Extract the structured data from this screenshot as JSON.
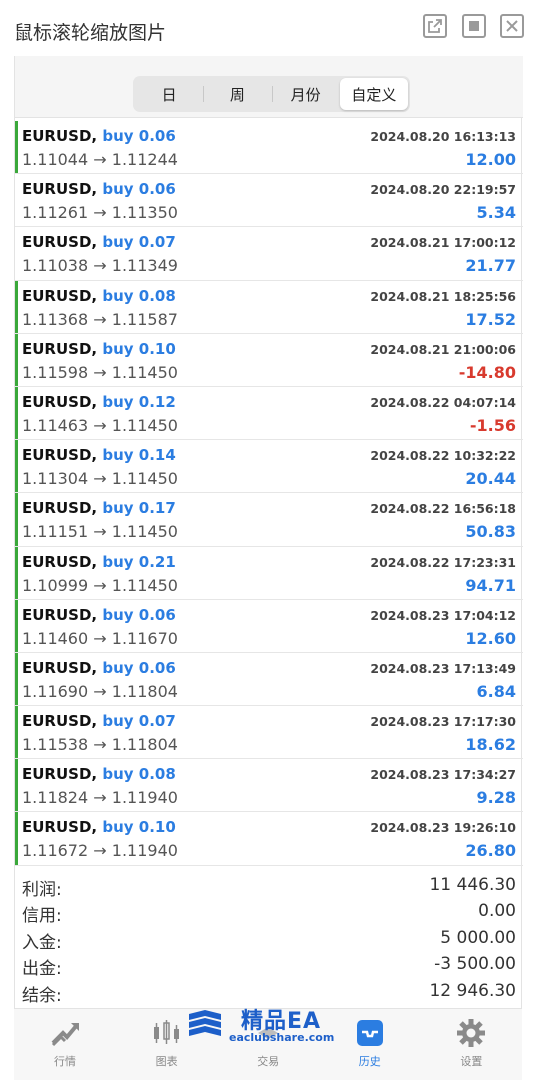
{
  "window": {
    "title": "鼠标滚轮缩放图片"
  },
  "period_tabs": [
    {
      "label": "日",
      "active": false
    },
    {
      "label": "周",
      "active": false
    },
    {
      "label": "月份",
      "active": false
    },
    {
      "label": "自定义",
      "active": true
    }
  ],
  "trades": [
    {
      "symbol": "EURUSD,",
      "side": "buy 0.06",
      "time": "2024.08.20 16:13:13",
      "open": "1.11044",
      "arrow": "→",
      "close": "1.11244",
      "profit": "12.00",
      "bar": true
    },
    {
      "symbol": "EURUSD,",
      "side": "buy 0.06",
      "time": "2024.08.20 22:19:57",
      "open": "1.11261",
      "arrow": "→",
      "close": "1.11350",
      "profit": "5.34",
      "bar": false
    },
    {
      "symbol": "EURUSD,",
      "side": "buy 0.07",
      "time": "2024.08.21 17:00:12",
      "open": "1.11038",
      "arrow": "→",
      "close": "1.11349",
      "profit": "21.77",
      "bar": false
    },
    {
      "symbol": "EURUSD,",
      "side": "buy 0.08",
      "time": "2024.08.21 18:25:56",
      "open": "1.11368",
      "arrow": "→",
      "close": "1.11587",
      "profit": "17.52",
      "bar": true
    },
    {
      "symbol": "EURUSD,",
      "side": "buy 0.10",
      "time": "2024.08.21 21:00:06",
      "open": "1.11598",
      "arrow": "→",
      "close": "1.11450",
      "profit": "-14.80",
      "bar": true
    },
    {
      "symbol": "EURUSD,",
      "side": "buy 0.12",
      "time": "2024.08.22 04:07:14",
      "open": "1.11463",
      "arrow": "→",
      "close": "1.11450",
      "profit": "-1.56",
      "bar": true
    },
    {
      "symbol": "EURUSD,",
      "side": "buy 0.14",
      "time": "2024.08.22 10:32:22",
      "open": "1.11304",
      "arrow": "→",
      "close": "1.11450",
      "profit": "20.44",
      "bar": true
    },
    {
      "symbol": "EURUSD,",
      "side": "buy 0.17",
      "time": "2024.08.22 16:56:18",
      "open": "1.11151",
      "arrow": "→",
      "close": "1.11450",
      "profit": "50.83",
      "bar": true
    },
    {
      "symbol": "EURUSD,",
      "side": "buy 0.21",
      "time": "2024.08.22 17:23:31",
      "open": "1.10999",
      "arrow": "→",
      "close": "1.11450",
      "profit": "94.71",
      "bar": true
    },
    {
      "symbol": "EURUSD,",
      "side": "buy 0.06",
      "time": "2024.08.23 17:04:12",
      "open": "1.11460",
      "arrow": "→",
      "close": "1.11670",
      "profit": "12.60",
      "bar": true
    },
    {
      "symbol": "EURUSD,",
      "side": "buy 0.06",
      "time": "2024.08.23 17:13:49",
      "open": "1.11690",
      "arrow": "→",
      "close": "1.11804",
      "profit": "6.84",
      "bar": true
    },
    {
      "symbol": "EURUSD,",
      "side": "buy 0.07",
      "time": "2024.08.23 17:17:30",
      "open": "1.11538",
      "arrow": "→",
      "close": "1.11804",
      "profit": "18.62",
      "bar": true
    },
    {
      "symbol": "EURUSD,",
      "side": "buy 0.08",
      "time": "2024.08.23 17:34:27",
      "open": "1.11824",
      "arrow": "→",
      "close": "1.11940",
      "profit": "9.28",
      "bar": true
    },
    {
      "symbol": "EURUSD,",
      "side": "buy 0.10",
      "time": "2024.08.23 19:26:10",
      "open": "1.11672",
      "arrow": "→",
      "close": "1.11940",
      "profit": "26.80",
      "bar": true
    }
  ],
  "summary": [
    {
      "label": "利润:",
      "value": "11 446.30"
    },
    {
      "label": "信用:",
      "value": "0.00"
    },
    {
      "label": "入金:",
      "value": "5 000.00"
    },
    {
      "label": "出金:",
      "value": "-3 500.00"
    },
    {
      "label": "结余:",
      "value": "12 946.30"
    }
  ],
  "tabbar": [
    {
      "label": "行情",
      "icon": "quotes-icon",
      "active": false
    },
    {
      "label": "图表",
      "icon": "chart-icon",
      "active": false
    },
    {
      "label": "交易",
      "icon": "trade-icon",
      "active": false
    },
    {
      "label": "历史",
      "icon": "history-icon",
      "active": true
    },
    {
      "label": "设置",
      "icon": "settings-icon",
      "active": false
    }
  ],
  "watermark": {
    "title": "精品EA",
    "url": "eaclubshare.com"
  },
  "colors": {
    "accent": "#2b7de1",
    "loss": "#d83a2e",
    "position_bar": "#3aa83a"
  }
}
